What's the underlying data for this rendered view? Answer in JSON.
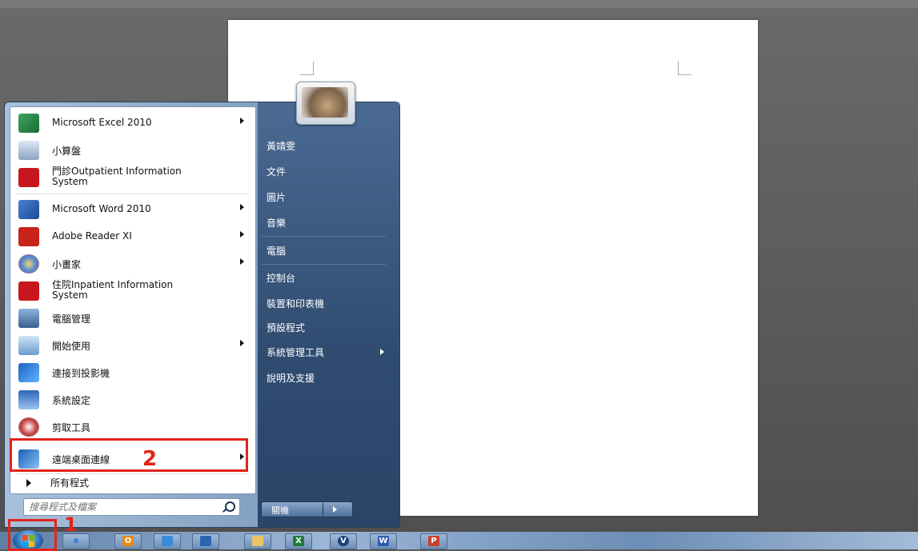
{
  "start_menu": {
    "pinned": [
      {
        "label": "Microsoft Excel 2010",
        "icon": "excel-icon",
        "has_submenu": true
      },
      {
        "label": "小算盤",
        "icon": "calculator-icon",
        "has_submenu": false
      },
      {
        "label": "門診Outpatient Information\nSystem",
        "icon": "outpatient-system-icon",
        "has_submenu": false
      }
    ],
    "recent": [
      {
        "label": "Microsoft Word 2010",
        "icon": "word-icon",
        "has_submenu": true
      },
      {
        "label": "Adobe Reader XI",
        "icon": "adobe-reader-icon",
        "has_submenu": true
      },
      {
        "label": "小畫家",
        "icon": "paint-icon",
        "has_submenu": true
      },
      {
        "label": "住院Inpatient Information\nSystem",
        "icon": "inpatient-system-icon",
        "has_submenu": false
      },
      {
        "label": "電腦管理",
        "icon": "computer-management-icon",
        "has_submenu": false
      },
      {
        "label": "開始使用",
        "icon": "getting-started-icon",
        "has_submenu": true
      },
      {
        "label": "連接到投影機",
        "icon": "projector-icon",
        "has_submenu": false
      },
      {
        "label": "系統設定",
        "icon": "system-config-icon",
        "has_submenu": false
      },
      {
        "label": "剪取工具",
        "icon": "snipping-tool-icon",
        "has_submenu": false
      },
      {
        "label": "遠端桌面連線",
        "icon": "remote-desktop-icon",
        "has_submenu": true
      }
    ],
    "all_programs_label": "所有程式",
    "search_placeholder": "搜尋程式及檔案",
    "right_items": [
      "黃靖雯",
      "文件",
      "圖片",
      "音樂",
      "電腦",
      "控制台",
      "裝置和印表機",
      "預設程式",
      "系統管理工具",
      "說明及支援"
    ],
    "shutdown_label": "關機"
  },
  "annotations": {
    "step1": "1",
    "step2": "2",
    "color": "#e2231a"
  },
  "taskbar": {
    "apps": [
      "internet-explorer-icon",
      "outlook-icon",
      "messenger-icon",
      "app-icon",
      "file-explorer-icon",
      "excel-icon",
      "app-v-icon",
      "word-icon",
      "powerpoint-icon"
    ],
    "labels": [
      "e",
      "O",
      "",
      "",
      "",
      "X",
      "V",
      "W",
      "P"
    ]
  }
}
